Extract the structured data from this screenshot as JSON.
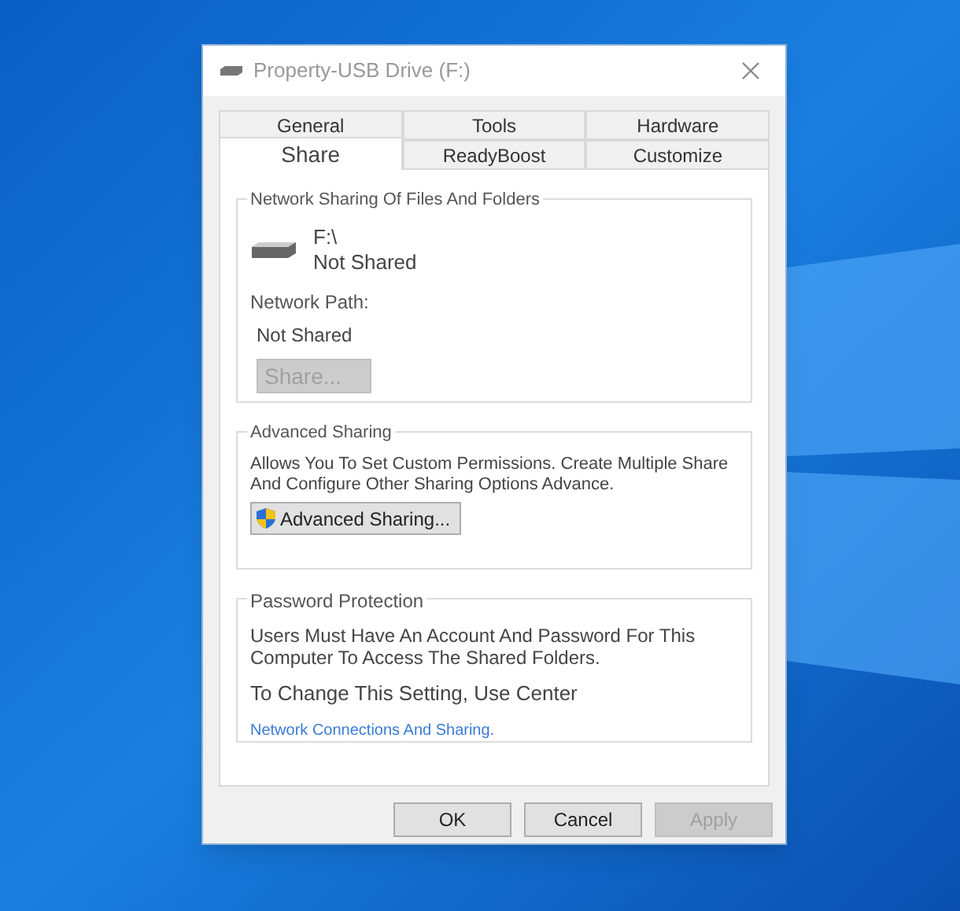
{
  "window": {
    "title": "Property-USB Drive (F:)"
  },
  "tab_rows": [
    [
      {
        "label": "General",
        "selected": false
      },
      {
        "label": "Tools",
        "selected": false
      },
      {
        "label": "Hardware",
        "selected": false
      }
    ],
    [
      {
        "label": "Share",
        "selected": true
      },
      {
        "label": "ReadyBoost",
        "selected": false
      },
      {
        "label": "Customize",
        "selected": false
      }
    ]
  ],
  "network_sharing": {
    "title": "Network Sharing Of Files And Folders",
    "drive": "F:\\",
    "drive_status": "Not Shared",
    "path_label": "Network Path:",
    "path_value": "Not Shared",
    "button": {
      "label": "Share...",
      "disabled": true
    }
  },
  "advanced_sharing": {
    "title": "Advanced Sharing",
    "description": "Allows You To Set Custom Permissions. Create Multiple Share And Configure Other Sharing Options Advance.",
    "button": {
      "label": "Advanced Sharing...",
      "disabled": false
    }
  },
  "password_protection": {
    "title": "Password Protection",
    "description": "Users Must Have An Account And Password For This Computer To Access The Shared Folders.",
    "hint": "To Change This Setting, Use Center",
    "link": "Network Connections And Sharing."
  },
  "buttons": [
    {
      "label": "OK",
      "disabled": false
    },
    {
      "label": "Cancel",
      "disabled": false
    },
    {
      "label": "Apply",
      "disabled": true
    }
  ]
}
